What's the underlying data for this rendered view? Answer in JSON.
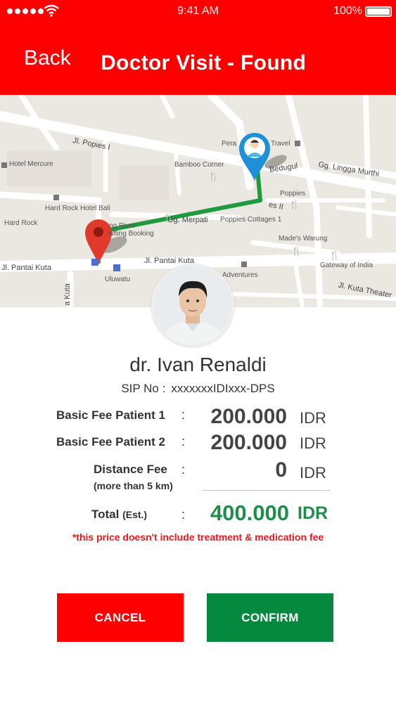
{
  "status_bar": {
    "time": "9:41 AM",
    "battery": "100%",
    "icons": [
      "signal-dots-icon",
      "wifi-icon",
      "battery-icon"
    ]
  },
  "header": {
    "back_label": "Back",
    "title": "Doctor Visit - Found",
    "color": "#ff0000"
  },
  "map": {
    "place_labels": {
      "peralta": "Pera",
      "travel": "Travel",
      "hotel_mercure": "Hotel Mercure",
      "bamboo_corner": "Bamboo Corner",
      "hard_rock_hotel": "Hard Rock Hotel Bali",
      "hard_rock": "Hard Rock",
      "poppies": "Poppies",
      "poppies_cottages": "Poppies Cottages 1",
      "mades_warung": "Made's Warung",
      "gateway_of_india": "Gateway of India",
      "uluwatu": "Uluwatu",
      "adventures": "Adventures",
      "rafting": "rafting Booking",
      "river": "ng River"
    },
    "street_labels": {
      "popies": "Jl. Popies I",
      "bedugul": "Bedugul",
      "lingga": "Gg. Lingga Murthi",
      "merpati": "Gg. Merpati",
      "pantai_kuta_left": "Jl. Pantai Kuta",
      "pantai_kuta_mid": "Jl. Pantai Kuta",
      "kuta_theater": "Jl. Kuta Theater",
      "kuta_vertical": "a Kuta",
      "popies_2": "es II"
    },
    "route_color": "#1f9a3f",
    "pins": [
      "doctor-location-pin",
      "patient-location-pin"
    ]
  },
  "doctor": {
    "name": "dr. Ivan Renaldi",
    "sip_label": "SIP No :",
    "sip_value": "xxxxxxxIDIxxx-DPS"
  },
  "fees": {
    "basic1": {
      "label": "Basic Fee Patient  1",
      "value": "200.000",
      "unit": "IDR"
    },
    "basic2": {
      "label": "Basic Fee Patient  2",
      "value": "200.000",
      "unit": "IDR"
    },
    "distance": {
      "label": "Distance Fee",
      "sub": "(more than 5 km)",
      "value": "0",
      "unit": "IDR"
    },
    "total": {
      "label": "Total",
      "label_suffix": "(Est.)",
      "value": "400.000",
      "unit": "IDR",
      "color": "#1e8f4a"
    },
    "colon": ":"
  },
  "note": "*this price doesn't include treatment & medication fee",
  "buttons": {
    "cancel": "CANCEL",
    "confirm": "CONFIRM",
    "cancel_color": "#ff0000",
    "confirm_color": "#05893e"
  }
}
